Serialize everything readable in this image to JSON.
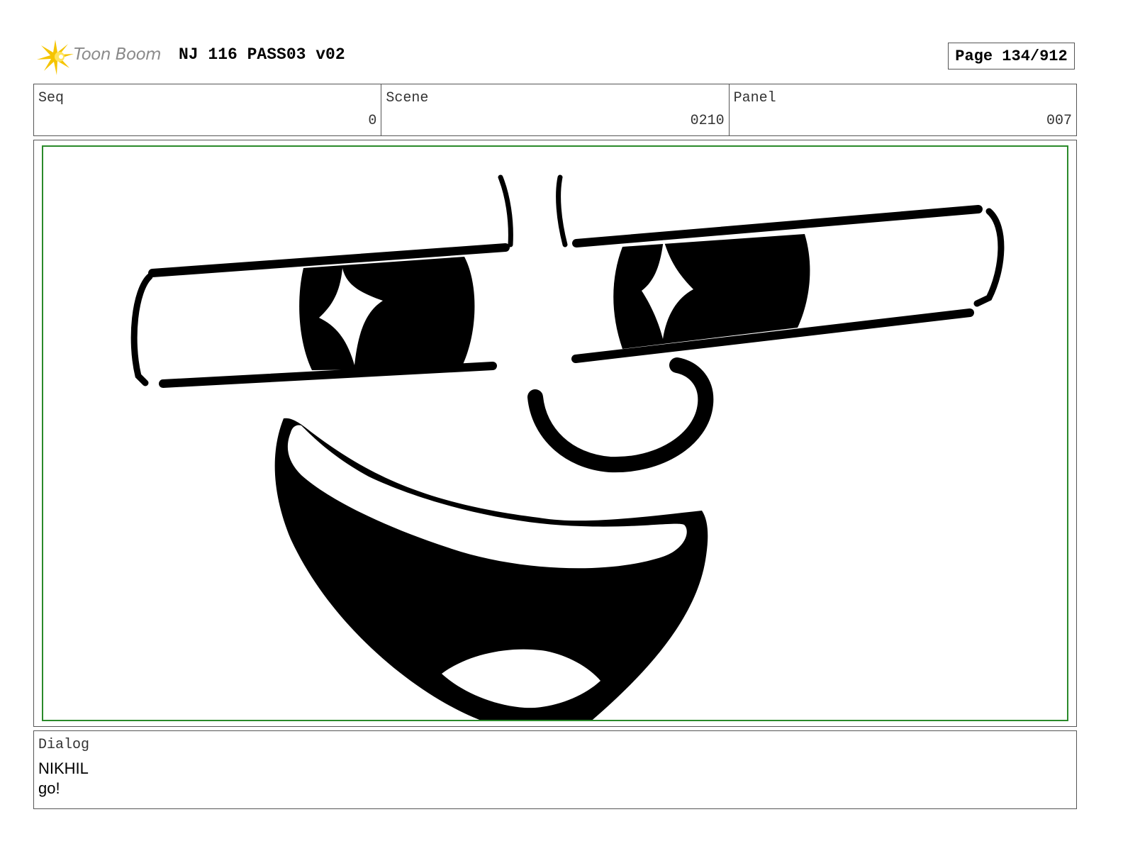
{
  "header": {
    "logo_text": "Toon Boom",
    "title": "NJ 116 PASS03 v02",
    "page_label": "Page 134/912"
  },
  "info": {
    "seq_label": "Seq",
    "seq_value": "0",
    "scene_label": "Scene",
    "scene_value": "0210",
    "panel_label": "Panel",
    "panel_value": "007"
  },
  "dialog": {
    "label": "Dialog",
    "speaker": "NIKHIL",
    "line": "go!"
  },
  "colors": {
    "panel_border": "#2a8a2a",
    "logo_accent": "#f5c400",
    "ink": "#000000"
  }
}
